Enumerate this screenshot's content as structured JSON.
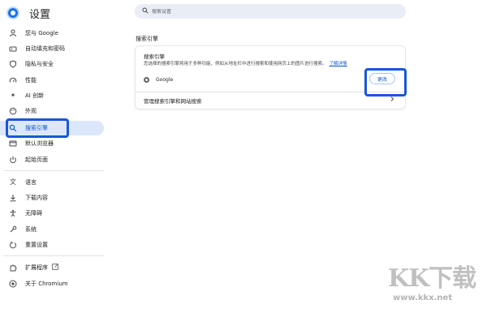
{
  "app": {
    "title": "设置"
  },
  "search": {
    "placeholder": "搜索设置"
  },
  "sidebar": {
    "items": [
      {
        "label": "您与 Google",
        "icon": "person-icon"
      },
      {
        "label": "自动填充和密码",
        "icon": "key-icon"
      },
      {
        "label": "隐私与安全",
        "icon": "shield-icon"
      },
      {
        "label": "性能",
        "icon": "speedometer-icon"
      },
      {
        "label": "AI 创新",
        "icon": "sparkle-icon"
      },
      {
        "label": "外观",
        "icon": "palette-icon"
      },
      {
        "label": "搜索引擎",
        "icon": "search-icon",
        "active": true
      },
      {
        "label": "默认浏览器",
        "icon": "browser-window-icon"
      },
      {
        "label": "起始页面",
        "icon": "power-icon"
      },
      {
        "label": "语言",
        "icon": "translate-icon"
      },
      {
        "label": "下载内容",
        "icon": "download-icon"
      },
      {
        "label": "无障碍",
        "icon": "accessibility-icon"
      },
      {
        "label": "系统",
        "icon": "wrench-icon"
      },
      {
        "label": "重置设置",
        "icon": "reset-icon"
      },
      {
        "label": "扩展程序",
        "icon": "puzzle-icon"
      },
      {
        "label": "关于 Chromium",
        "icon": "chromium-icon"
      }
    ]
  },
  "main": {
    "section_title": "搜索引擎",
    "card": {
      "heading": "搜索引擎",
      "description": "您选择的搜索引擎将用于多种功能，例如从地址栏中进行搜索和使用网页上的图片进行搜索。",
      "learn_more": "了解详情",
      "engine_name": "Google",
      "change_button": "更改",
      "manage_label": "管理搜索引擎和网站搜索"
    }
  },
  "watermark": {
    "text": "KK下载",
    "url": "www.kkx.net"
  },
  "colors": {
    "accent": "#0b57d0",
    "active_bg": "#dce7fb",
    "highlight_box": "#1a56db"
  }
}
